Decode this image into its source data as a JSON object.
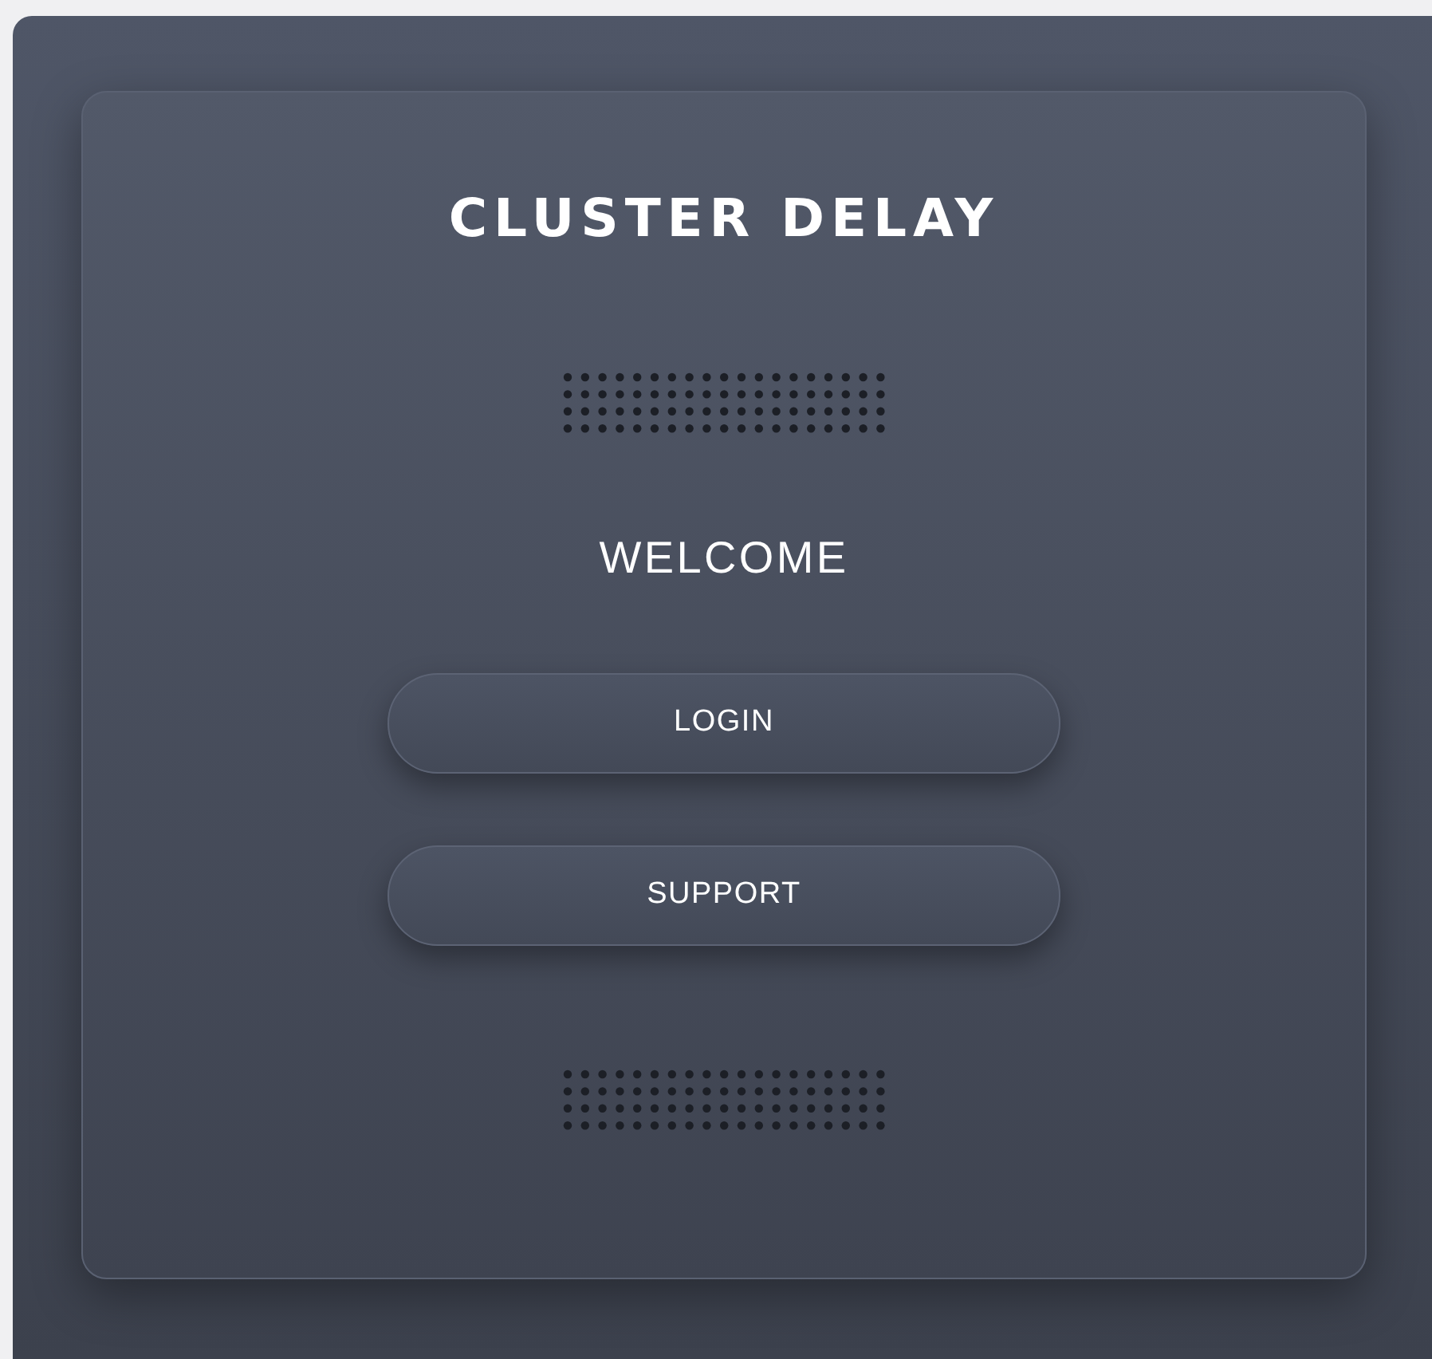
{
  "card": {
    "title": "CLUSTER DELAY",
    "heading": "WELCOME",
    "buttons": [
      {
        "label": "LOGIN"
      },
      {
        "label": "SUPPORT"
      }
    ]
  }
}
